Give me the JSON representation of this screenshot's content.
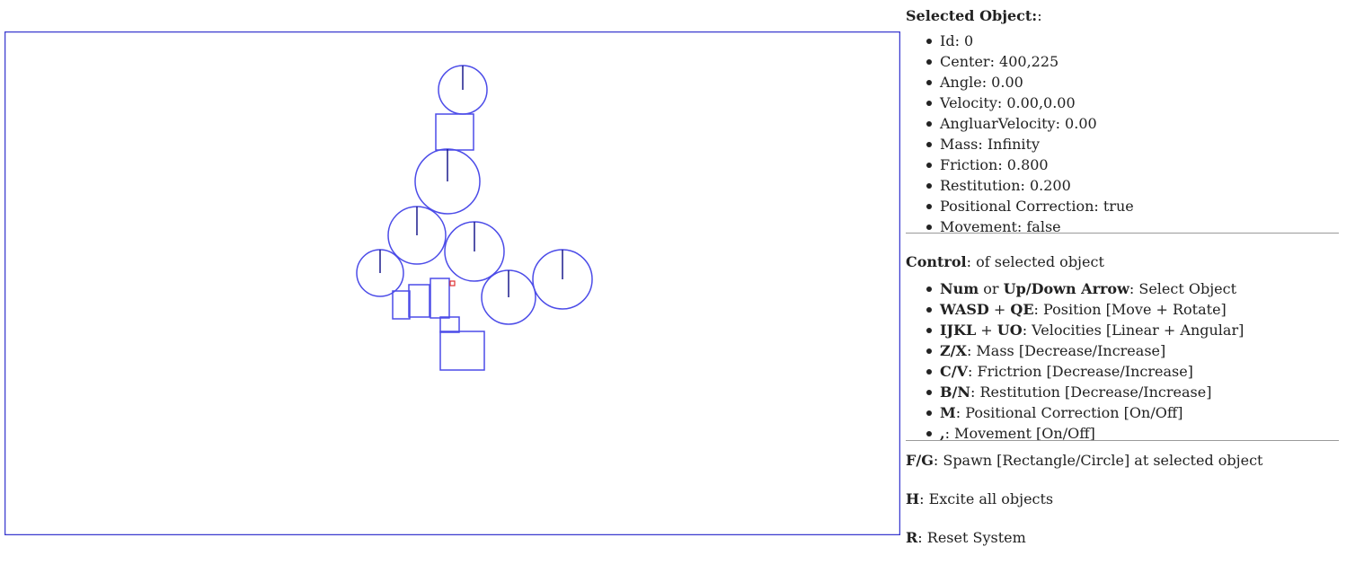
{
  "selected_object": {
    "title": "Selected Object:",
    "title_suffix": ":",
    "props": [
      {
        "label": "Id: ",
        "value": "0"
      },
      {
        "label": "Center: ",
        "value": "400,225"
      },
      {
        "label": "Angle: ",
        "value": "0.00"
      },
      {
        "label": "Velocity: ",
        "value": "0.00,0.00"
      },
      {
        "label": "AngluarVelocity: ",
        "value": "0.00"
      },
      {
        "label": "Mass: ",
        "value": "Infinity"
      },
      {
        "label": "Friction: ",
        "value": "0.800"
      },
      {
        "label": "Restitution: ",
        "value": "0.200"
      },
      {
        "label": "Positional Correction: ",
        "value": "true"
      },
      {
        "label": "Movement: ",
        "value": "false"
      }
    ]
  },
  "control": {
    "title": "Control",
    "subtitle": ": of selected object",
    "items": [
      {
        "key": "Num",
        "mid": " or ",
        "key2": "Up/Down Arrow",
        "desc": ": Select Object"
      },
      {
        "key": "WASD",
        "mid": " + ",
        "key2": "QE",
        "desc": ": Position [Move + Rotate]"
      },
      {
        "key": "IJKL",
        "mid": " + ",
        "key2": "UO",
        "desc": ": Velocities [Linear + Angular]"
      },
      {
        "key": "Z/X",
        "mid": "",
        "key2": "",
        "desc": ": Mass [Decrease/Increase]"
      },
      {
        "key": "C/V",
        "mid": "",
        "key2": "",
        "desc": ": Frictrion [Decrease/Increase]"
      },
      {
        "key": "B/N",
        "mid": "",
        "key2": "",
        "desc": ": Restitution [Decrease/Increase]"
      },
      {
        "key": "M",
        "mid": "",
        "key2": "",
        "desc": ": Positional Correction [On/Off]"
      },
      {
        "key": ",",
        "mid": "",
        "key2": "",
        "desc": ": Movement [On/Off]"
      }
    ]
  },
  "extra_controls": [
    {
      "key": "F/G",
      "desc": ": Spawn [Rectangle/Circle] at selected object"
    },
    {
      "key": "H",
      "desc": ": Excite all objects"
    },
    {
      "key": "R",
      "desc": ": Reset System"
    }
  ],
  "colors": {
    "shape_stroke": "#4c4ce8",
    "rotation_marker": "#1a1a8c",
    "selected_marker": "#e03030",
    "frame": "#3a3acf",
    "separator": "#9a9a9a"
  }
}
